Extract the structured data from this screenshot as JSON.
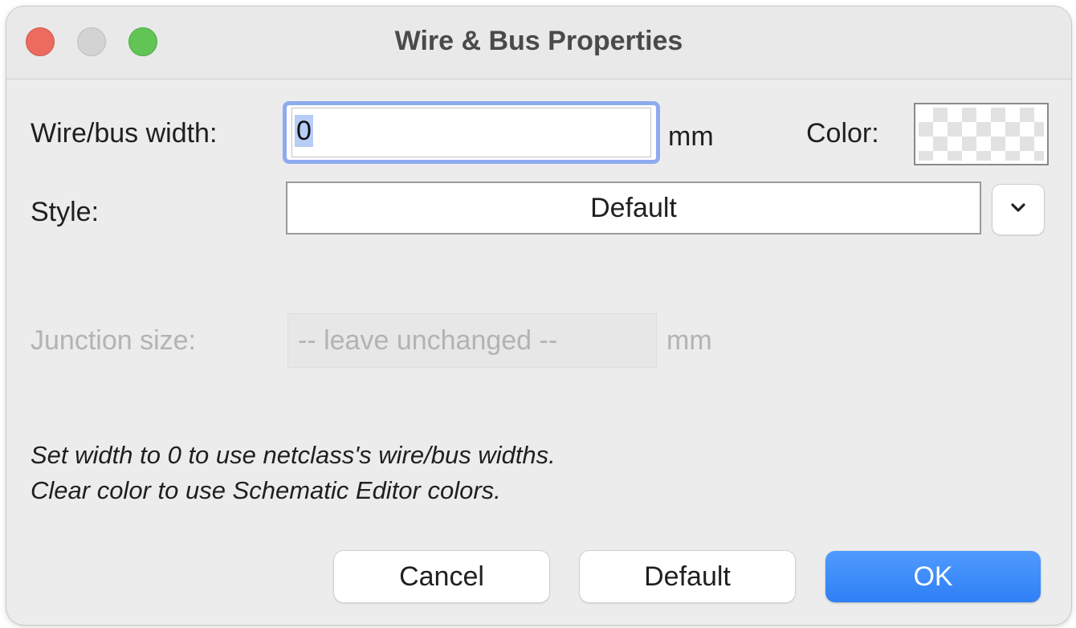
{
  "window": {
    "title": "Wire & Bus Properties"
  },
  "form": {
    "width_label": "Wire/bus width:",
    "width_value": "0",
    "width_unit": "mm",
    "color_label": "Color:",
    "style_label": "Style:",
    "style_value": "Default",
    "junction_label": "Junction size:",
    "junction_placeholder": "-- leave unchanged --",
    "junction_unit": "mm"
  },
  "hints": {
    "line1": "Set width to 0 to use netclass's wire/bus widths.",
    "line2": "Clear color to use Schematic Editor colors."
  },
  "buttons": {
    "cancel": "Cancel",
    "default": "Default",
    "ok": "OK"
  },
  "colors": {
    "ok_button": "#3a87f8",
    "focus_ring": "#8eaaf0",
    "close_light": "#ec6a5e",
    "minimize_light": "#d3d3d3",
    "zoom_light": "#61c454"
  }
}
